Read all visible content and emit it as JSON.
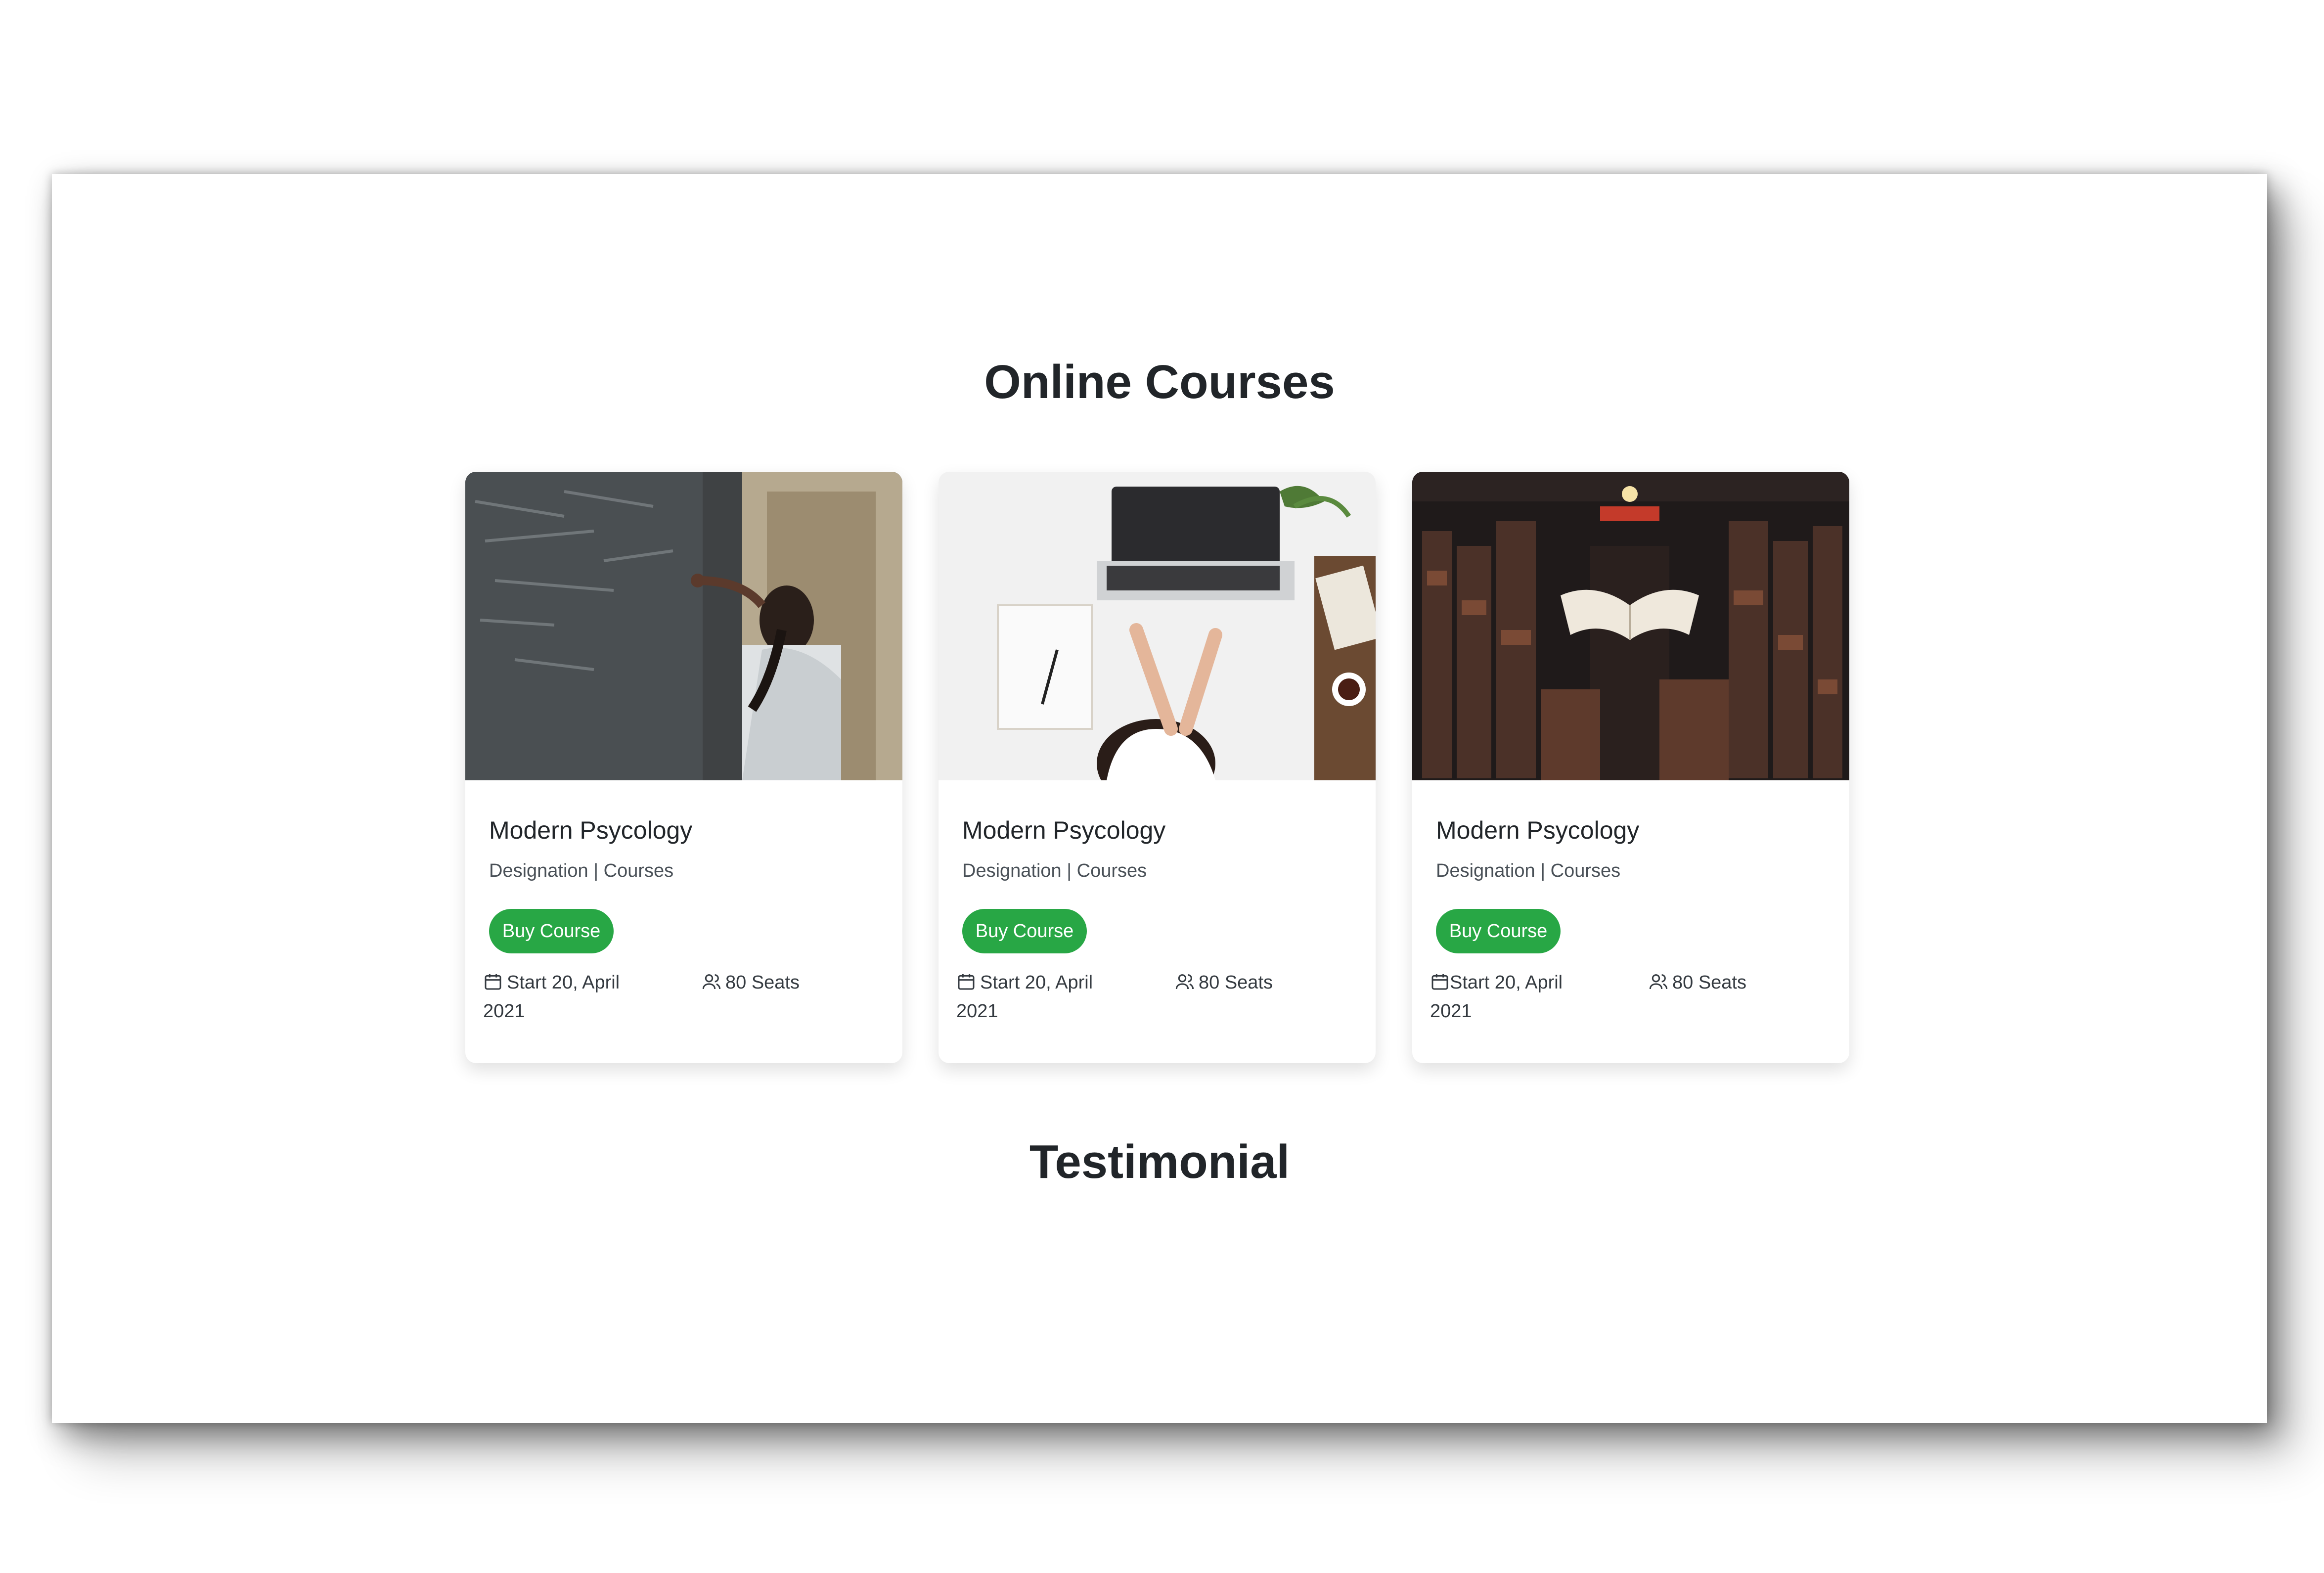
{
  "sections": {
    "courses_title": "Online Courses",
    "testimonial_title": "Testimonial"
  },
  "courses": [
    {
      "image": "photo-student-at-chalkboard",
      "title": "Modern Psycology",
      "subtitle": "Designation | Courses",
      "button_label": "Buy Course",
      "date_label": "Start 20, April 2021",
      "seats_label": "80 Seats"
    },
    {
      "image": "photo-desk-with-laptop",
      "title": "Modern Psycology",
      "subtitle": "Designation | Courses",
      "button_label": "Buy Course",
      "date_label": "Start 20, April 2021",
      "seats_label": "80 Seats"
    },
    {
      "image": "photo-library-flying-book",
      "title": "Modern Psycology",
      "subtitle": "Designation | Courses",
      "button_label": "Buy Course",
      "date_label": "Start 20, April 2021",
      "seats_label": "80 Seats"
    }
  ],
  "colors": {
    "button": "#28a745",
    "heading": "#212529"
  },
  "icons": {
    "date": "calendar-icon",
    "seats": "users-icon"
  }
}
